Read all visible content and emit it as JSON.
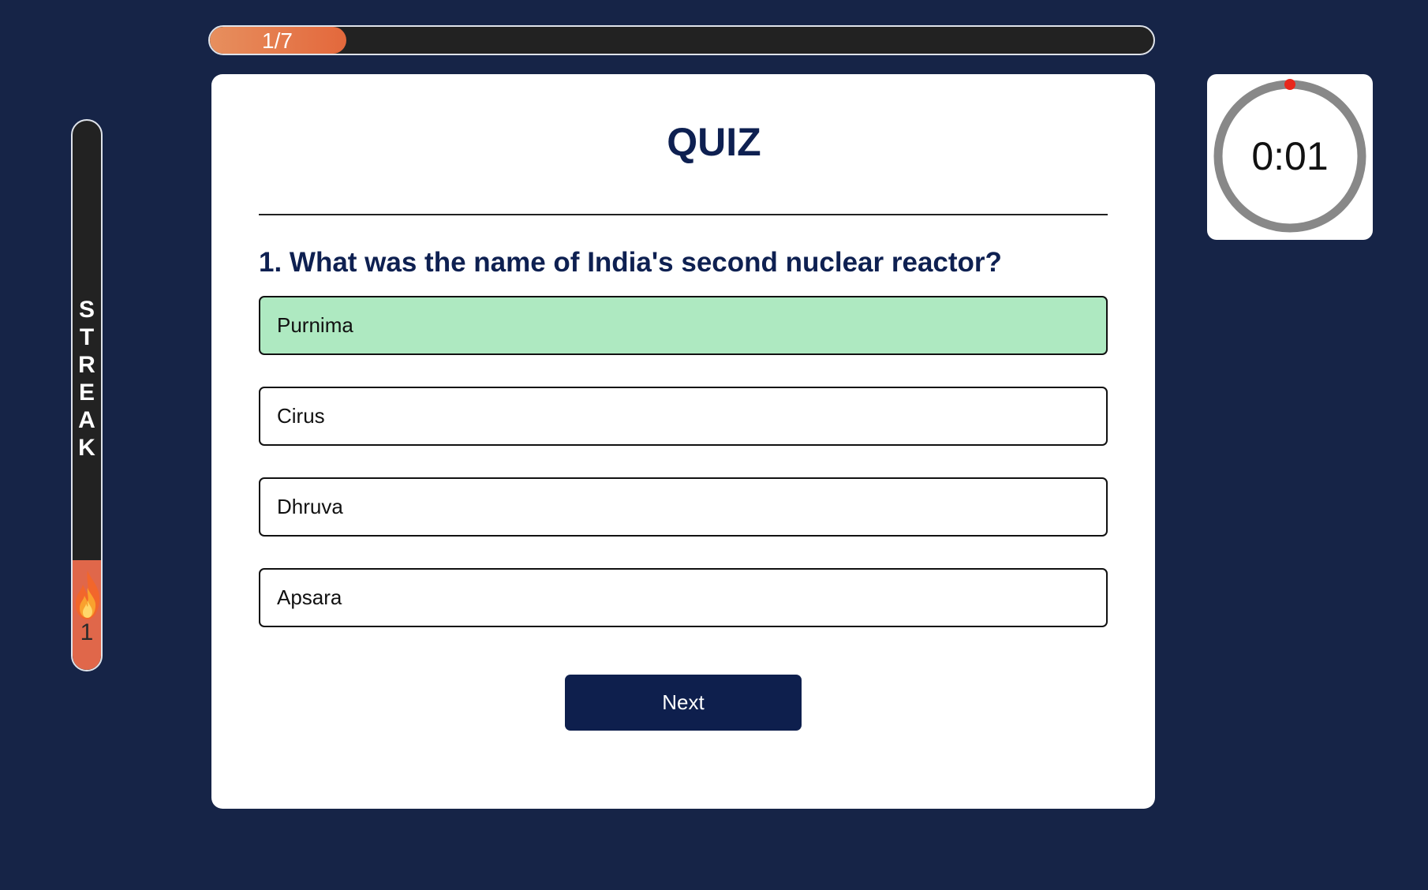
{
  "progress": {
    "label": "1/7",
    "current": 1,
    "total": 7,
    "fill_fraction": 0.145,
    "colors": {
      "fill_start": "#e78f5e",
      "fill_end": "#e3683c",
      "track": "#222222"
    }
  },
  "streak": {
    "title": "STREAK",
    "letters": [
      "S",
      "T",
      "R",
      "E",
      "A",
      "K"
    ],
    "count": "1",
    "icon": "flame-icon",
    "fill_fraction": 0.2,
    "colors": {
      "fill": "#e0674a",
      "track": "#222222"
    }
  },
  "quiz": {
    "title": "QUIZ",
    "question": "1. What was the name of India's second nuclear reactor?",
    "options": [
      {
        "label": "Purnima",
        "selected": true
      },
      {
        "label": "Cirus",
        "selected": false
      },
      {
        "label": "Dhruva",
        "selected": false
      },
      {
        "label": "Apsara",
        "selected": false
      }
    ],
    "next_label": "Next",
    "colors": {
      "title": "#0e2051",
      "selected_option": "#aee9c1",
      "button": "#0e1f4d"
    }
  },
  "timer": {
    "display": "0:01",
    "elapsed_fraction": 0.0,
    "colors": {
      "ring": "#888888",
      "marker": "#e8281c"
    }
  },
  "theme": {
    "background": "#162447"
  }
}
